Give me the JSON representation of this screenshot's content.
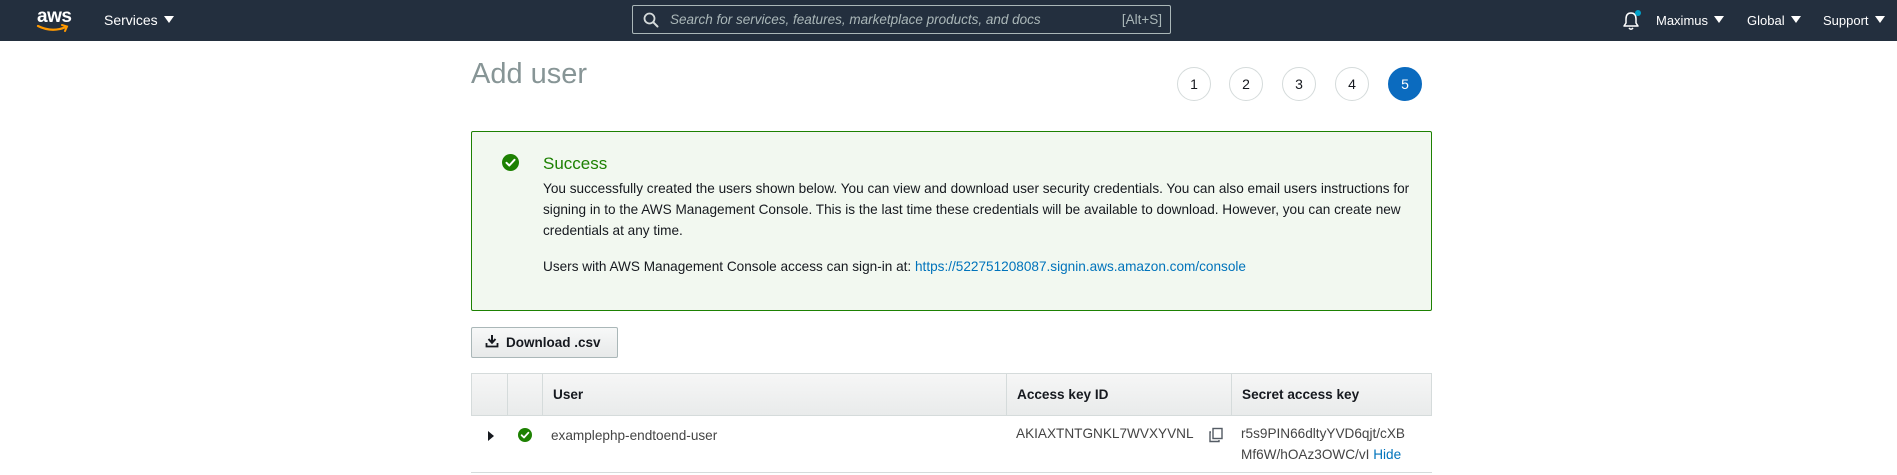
{
  "nav": {
    "logo_text": "aws",
    "services_label": "Services",
    "search_placeholder": "Search for services, features, marketplace products, and docs",
    "search_shortcut": "[Alt+S]",
    "account_label": "Maximus",
    "region_label": "Global",
    "support_label": "Support"
  },
  "page": {
    "title": "Add user"
  },
  "steps": [
    "1",
    "2",
    "3",
    "4",
    "5"
  ],
  "active_step": 5,
  "alert": {
    "title": "Success",
    "message": "You successfully created the users shown below. You can view and download user security credentials. You can also email users instructions for signing in to the AWS Management Console. This is the last time these credentials will be available to download. However, you can create new credentials at any time.",
    "signin_prefix": "Users with AWS Management Console access can sign-in at:",
    "signin_url": "https://522751208087.signin.aws.amazon.com/console"
  },
  "download_label": "Download .csv",
  "table": {
    "columns": [
      "User",
      "Access key ID",
      "Secret access key"
    ],
    "rows": [
      {
        "user": "examplephp-endtoend-user",
        "access_key_id": "AKIAXTNTGNKL7WVXYVNL",
        "secret_line1": "r5s9PIN66dltyYVD6qjt/cXB",
        "secret_line2": "Mf6W/hOAz3OWC/vI",
        "hide_label": "Hide"
      }
    ]
  },
  "colors": {
    "nav_bg": "#232f3e",
    "success_green": "#1d8102",
    "link_blue": "#0073bb",
    "active_step": "#0b6bbf"
  }
}
